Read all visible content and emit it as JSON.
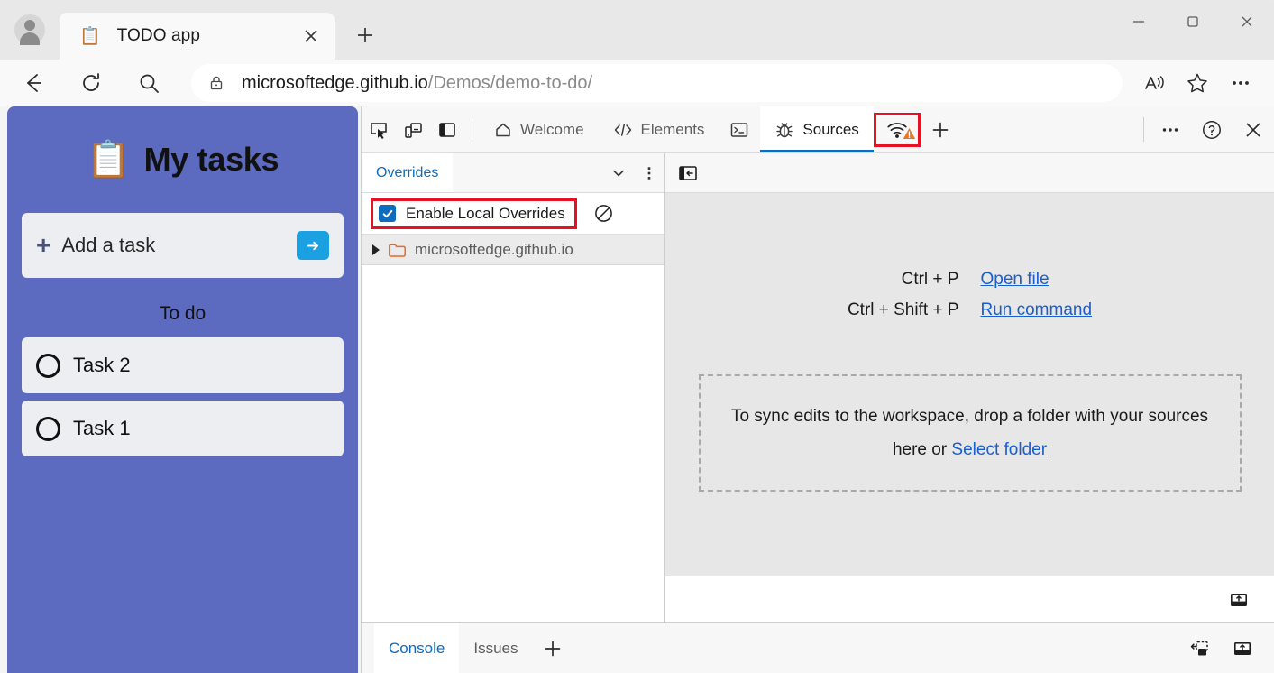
{
  "window": {
    "controls": {
      "minimize": "minimize-icon",
      "maximize": "maximize-icon",
      "close": "close-icon"
    }
  },
  "browser": {
    "tab": {
      "favicon": "📋",
      "title": "TODO app",
      "close_label": "×"
    },
    "new_tab_label": "+",
    "nav": {
      "back": "back-arrow-icon",
      "refresh": "refresh-icon",
      "search": "search-icon"
    },
    "omnibox": {
      "lock": "lock-icon",
      "url_host": "microsoftedge.github.io",
      "url_path": "/Demos/demo-to-do/"
    },
    "actions": {
      "read_aloud": "read-aloud-icon",
      "favorites": "star-icon",
      "settings": "ellipsis-icon"
    }
  },
  "todo_app": {
    "clipboard_emoji": "📋",
    "title": "My tasks",
    "add_task": {
      "plus": "+",
      "placeholder": "Add a task",
      "submit_icon": "→"
    },
    "section_label": "To do",
    "tasks": [
      {
        "label": "Task 2",
        "done": false
      },
      {
        "label": "Task 1",
        "done": false
      }
    ]
  },
  "devtools": {
    "toolbar_tools": [
      {
        "name": "inspect-element",
        "icon": "inspect-icon"
      },
      {
        "name": "device-emulation",
        "icon": "device-icon"
      },
      {
        "name": "dock-side",
        "icon": "dock-panel-icon"
      }
    ],
    "tabs": [
      {
        "label": "Welcome",
        "icon": "home-icon",
        "active": false
      },
      {
        "label": "Elements",
        "icon": "code-icon",
        "active": false
      },
      {
        "label": "",
        "icon": "console-icon",
        "active": false
      },
      {
        "label": "Sources",
        "icon": "bug-icon",
        "active": true
      }
    ],
    "network_tab": {
      "icon": "network-wifi-icon",
      "warning_badge": "warning-triangle-icon",
      "highlighted": true
    },
    "add_tab_label": "+",
    "right_actions": {
      "more": "ellipsis-icon",
      "help": "help-icon",
      "close": "close-icon"
    },
    "sidebar": {
      "tab_label": "Overrides",
      "chevron": "chevron-down-icon",
      "more": "kebab-menu-icon",
      "enable_overrides": {
        "label": "Enable Local Overrides",
        "checked": true,
        "highlighted": true
      },
      "clear_icon": "ban-icon",
      "tree": [
        {
          "label": "microsoftedge.github.io",
          "icon": "folder-icon",
          "expanded": false
        }
      ]
    },
    "editor": {
      "panel_toggle_icon": "show-navigator-icon",
      "shortcuts": [
        {
          "keys": "Ctrl + P",
          "action": "Open file"
        },
        {
          "keys": "Ctrl + Shift + P",
          "action": "Run command"
        }
      ],
      "dropzone": {
        "text_before": "To sync edits to the workspace, drop a folder with your sources here or",
        "link": "Select folder"
      },
      "bottom_icon": "show-drawer-icon"
    },
    "drawer": {
      "tabs": [
        {
          "label": "Console",
          "active": true
        },
        {
          "label": "Issues",
          "active": false
        }
      ],
      "add_label": "+",
      "right_icons": [
        {
          "name": "console-settings-icon"
        },
        {
          "name": "show-drawer-icon"
        }
      ]
    }
  },
  "colors": {
    "accent_blue": "#0f6cbd",
    "link_blue": "#1a5fd0",
    "highlight_red": "#e81123",
    "app_purple": "#5c6bc0",
    "folder_orange": "#e8692b"
  }
}
